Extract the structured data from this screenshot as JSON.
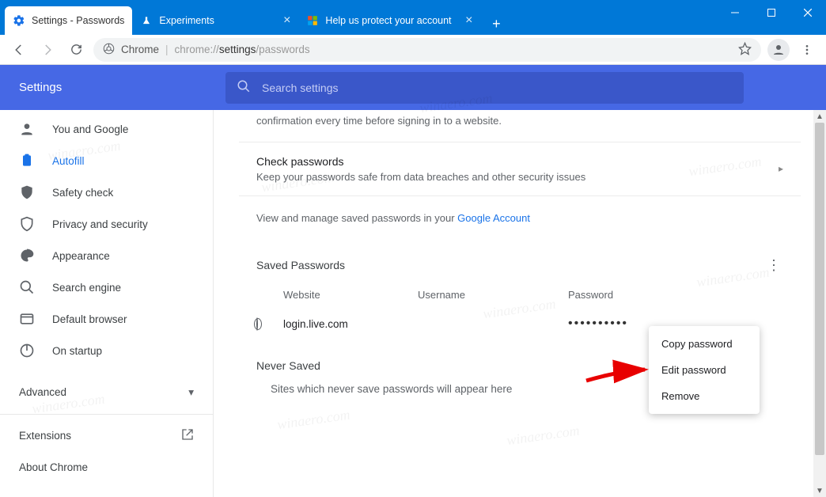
{
  "window": {
    "tabs": [
      {
        "label": "Settings - Passwords",
        "active": true
      },
      {
        "label": "Experiments",
        "active": false
      },
      {
        "label": "Help us protect your account",
        "active": false
      }
    ]
  },
  "omnibox": {
    "scheme": "Chrome",
    "path_prefix": "chrome://",
    "path_mid": "settings",
    "path_suffix": "/passwords"
  },
  "header": {
    "title": "Settings",
    "search_placeholder": "Search settings"
  },
  "sidebar": {
    "items": [
      {
        "label": "You and Google"
      },
      {
        "label": "Autofill"
      },
      {
        "label": "Safety check"
      },
      {
        "label": "Privacy and security"
      },
      {
        "label": "Appearance"
      },
      {
        "label": "Search engine"
      },
      {
        "label": "Default browser"
      },
      {
        "label": "On startup"
      }
    ],
    "advanced": "Advanced",
    "extensions": "Extensions",
    "about": "About Chrome"
  },
  "main": {
    "confirm_tail": "confirmation every time before signing in to a website.",
    "check": {
      "title": "Check passwords",
      "sub": "Keep your passwords safe from data breaches and other security issues"
    },
    "manage_prefix": "View and manage saved passwords in your ",
    "manage_link": "Google Account",
    "saved": {
      "header": "Saved Passwords",
      "cols": {
        "website": "Website",
        "username": "Username",
        "password": "Password"
      },
      "rows": [
        {
          "site": "login.live.com",
          "password_mask": "••••••••••"
        }
      ]
    },
    "never": {
      "header": "Never Saved",
      "text": "Sites which never save passwords will appear here"
    }
  },
  "context_menu": {
    "items": [
      "Copy password",
      "Edit password",
      "Remove"
    ]
  },
  "watermark": "winaero.com"
}
